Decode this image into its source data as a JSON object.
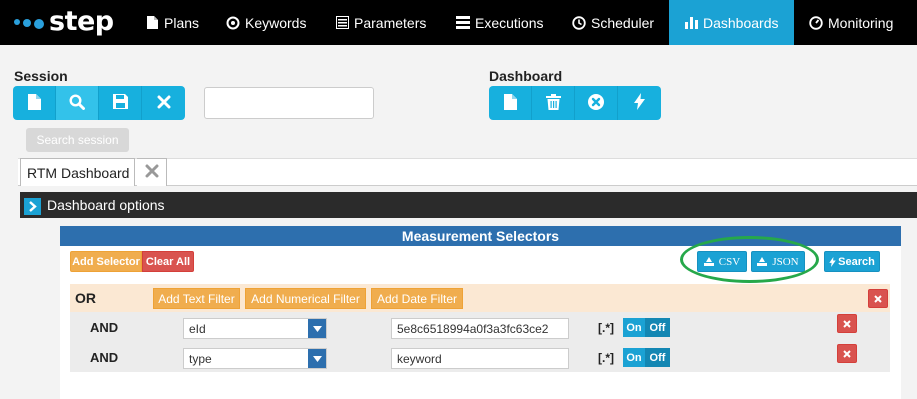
{
  "app": {
    "logo_text": "step",
    "brand_color": "#1ba2d4"
  },
  "nav": {
    "items": [
      {
        "label": "Plans",
        "icon": "file-icon"
      },
      {
        "label": "Keywords",
        "icon": "target-icon"
      },
      {
        "label": "Parameters",
        "icon": "list-icon"
      },
      {
        "label": "Executions",
        "icon": "tasks-icon"
      },
      {
        "label": "Scheduler",
        "icon": "clock-icon"
      },
      {
        "label": "Dashboards",
        "icon": "bar-chart-icon",
        "active": true
      },
      {
        "label": "Monitoring",
        "icon": "dashboard-gauge-icon"
      }
    ]
  },
  "session": {
    "label": "Session",
    "buttons": [
      "new-file-icon",
      "search-icon",
      "save-icon",
      "close-icon"
    ],
    "input_value": "",
    "tooltip": "Search session"
  },
  "dashboard": {
    "label": "Dashboard",
    "buttons": [
      "new-file-icon",
      "trash-icon",
      "remove-circle-icon",
      "flash-icon"
    ]
  },
  "tabs": [
    {
      "label": "RTM Dashboard"
    }
  ],
  "options": {
    "label": "Dashboard options"
  },
  "selectors": {
    "title": "Measurement Selectors",
    "add_selector": "Add Selector",
    "clear_all": "Clear All",
    "csv": "CSV",
    "json": "JSON",
    "search": "Search",
    "or_group": {
      "label": "OR",
      "add_text": "Add Text Filter",
      "add_numerical": "Add Numerical Filter",
      "add_date": "Add Date Filter",
      "rows": [
        {
          "op": "AND",
          "field": "eId",
          "value": "5e8c6518994a0f3a3fc63ce2",
          "regex": "[.*]",
          "on": "On",
          "off": "Off"
        },
        {
          "op": "AND",
          "field": "type",
          "value": "keyword",
          "regex": "[.*]",
          "on": "On",
          "off": "Off"
        }
      ]
    }
  }
}
